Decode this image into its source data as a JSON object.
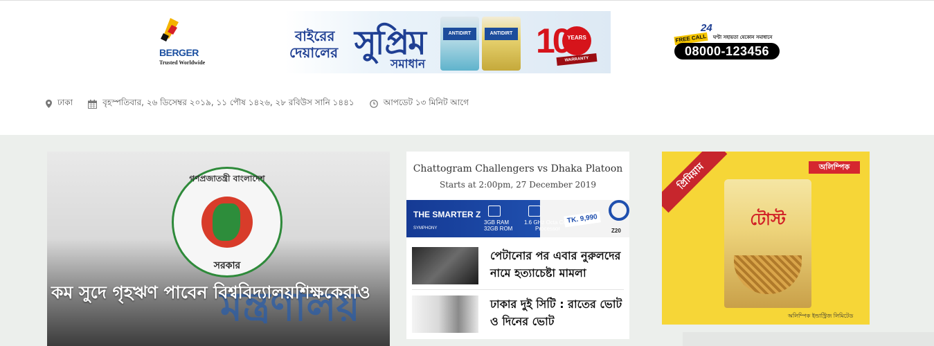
{
  "banner_ad": {
    "brand": "BERGER",
    "brand_tagline": "Trusted Worldwide",
    "headline_line1": "বাইরের",
    "headline_line2": "দেয়ালের",
    "headline_big": "সুপ্রিম",
    "headline_small": "সমাধান",
    "product": "ANTIDIRT",
    "warranty_years": "10",
    "warranty_circle": "YEARS",
    "warranty_band": "WARRANTY",
    "free_call": "FREE CALL",
    "hours": "24",
    "hotline_sub": "ঘণ্টা সহায়তা যেকোন সমাধানে",
    "phone": "08000-123456"
  },
  "meta": {
    "location": "ঢাকা",
    "date": "বৃহস্পতিবার, ২৬ ডিসেম্বর ২০১৯, ১১ পৌষ ১৪২৬, ২৮ রবিউস সানি ১৪৪১",
    "updated": "আপডেট ১৩ মিনিট আগে"
  },
  "lead_story": {
    "seal_top": "গণপ্রজাতন্ত্রী বাংলাদেশ",
    "seal_bottom": "সরকার",
    "bg_text": "মন্ত্রণালয়",
    "headline": "কম সুদে গৃহঋণ পাবেন বিশ্ববিদ্যালয়শিক্ষকেরাও"
  },
  "match": {
    "title": "Chattogram Challengers vs Dhaka Platoon",
    "time": "Starts at 2:00pm, 27 December 2019"
  },
  "phone_ad": {
    "brand": "THE SMARTER Z",
    "maker": "SYMPHONY",
    "spec_ram": "3GB RAM",
    "spec_rom": "32GB ROM",
    "spec_cpu": "1.6 GHz Octa Core",
    "spec_cpu2": "Processor",
    "price": "TK. 9,990",
    "model": "Z20"
  },
  "news": [
    {
      "title": "পেটানোর পর এবার নুরুলদের নামে হত্যাচেষ্টা মামলা"
    },
    {
      "title": "ঢাকার দুই সিটি : রাতের ভোট ও দিনের ভোট"
    }
  ],
  "right_ad": {
    "ribbon": "প্রিমিয়াম",
    "brand": "অলিম্পিক",
    "product": "টোস্ট",
    "company": "অলিম্পিক ইন্ডাস্ট্রিজ লিমিটেড"
  },
  "colors": {
    "page_bg": "#ecefec",
    "brand_blue": "#1f3f93",
    "accent_red": "#d6141b",
    "ad_yellow": "#f6d637"
  }
}
